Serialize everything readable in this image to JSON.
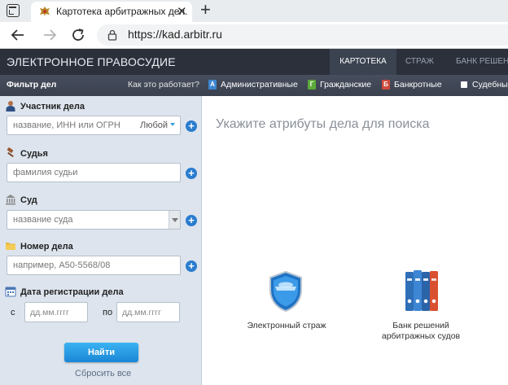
{
  "browser": {
    "tab_title": "Картотека арбитражных дел.",
    "url": "https://kad.arbitr.ru"
  },
  "header": {
    "logo": "ЭЛЕКТРОННОЕ ПРАВОСУДИЕ",
    "nav": [
      "КАРТОТЕКА",
      "СТРАЖ",
      "БАНК РЕШЕНИ"
    ]
  },
  "filterbar": {
    "title": "Фильтр дел",
    "how": "Как это работает?",
    "types": [
      "Административные",
      "Гражданские",
      "Банкротные",
      "Судебные"
    ],
    "type_icons": [
      "A",
      "Г",
      "Б"
    ]
  },
  "sidebar": {
    "participant_label": "Участник дела",
    "participant_placeholder": "название, ИНН или ОГРН",
    "participant_mode": "Любой",
    "judge_label": "Судья",
    "judge_placeholder": "фамилия судьи",
    "court_label": "Суд",
    "court_placeholder": "название суда",
    "number_label": "Номер дела",
    "number_placeholder": "например, А50-5568/08",
    "date_label": "Дата регистрации дела",
    "date_from": "с",
    "date_to": "по",
    "date_placeholder": "дд.мм.гггг",
    "find": "Найти",
    "reset": "Сбросить все"
  },
  "main": {
    "title": "Укажите атрибуты дела для поиска",
    "tile_guard": "Электронный страж",
    "tile_bank_line1": "Банк решений",
    "tile_bank_line2": "арбитражных судов"
  },
  "colors": {
    "header_bg": "#2b303b",
    "sidebar_bg": "#dde4ed",
    "accent": "#2a7ccf",
    "find_button": "#1a86d6"
  }
}
